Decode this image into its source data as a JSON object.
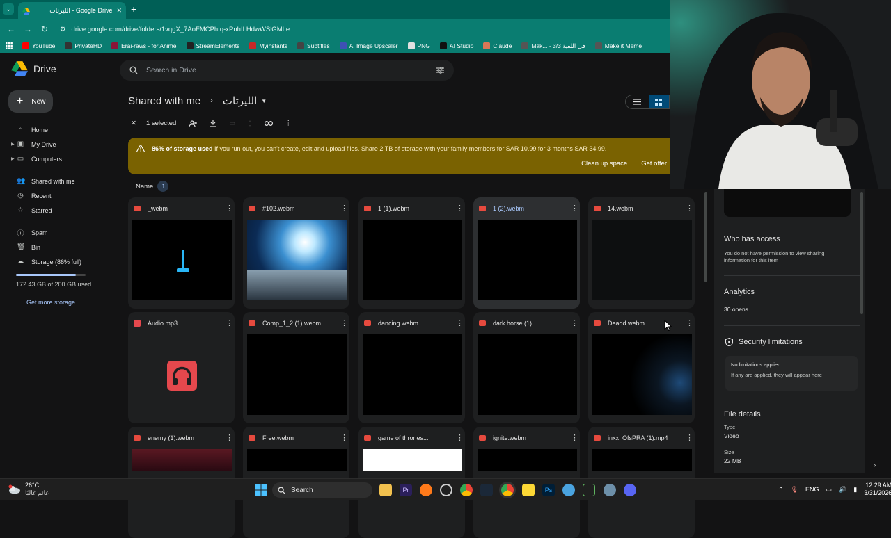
{
  "browser": {
    "tab_title": "الليرتات - Google Drive",
    "url": "drive.google.com/drive/folders/1vqgX_7AoFMCPhtq-xPnhILHdwWSlGMLe",
    "bookmarks": [
      {
        "label": "YouTube",
        "color": "#ff0000"
      },
      {
        "label": "PrivateHD",
        "color": "#333333"
      },
      {
        "label": "Erai-raws - for Anime",
        "color": "#8a1538"
      },
      {
        "label": "StreamElements",
        "color": "#222222"
      },
      {
        "label": "Myinstants",
        "color": "#c62828"
      },
      {
        "label": "Subtitles",
        "color": "#444444"
      },
      {
        "label": "AI Image Upscaler",
        "color": "#3f51b5"
      },
      {
        "label": "PNG",
        "color": "#e0e0e0"
      },
      {
        "label": "AI Studio",
        "color": "#111111"
      },
      {
        "label": "Claude",
        "color": "#d97757"
      },
      {
        "label": "Mak... - 3/3 في اللعبة",
        "color": "#555555"
      },
      {
        "label": "Make it Meme",
        "color": "#555555"
      }
    ]
  },
  "drive": {
    "app_name": "Drive",
    "search_placeholder": "Search in Drive",
    "new_label": "New",
    "nav": [
      {
        "label": "Home",
        "icon": "home-icon"
      },
      {
        "label": "My Drive",
        "icon": "my-drive-icon"
      },
      {
        "label": "Computers",
        "icon": "computers-icon"
      },
      {
        "label": "Shared with me",
        "icon": "shared-icon"
      },
      {
        "label": "Recent",
        "icon": "recent-icon"
      },
      {
        "label": "Starred",
        "icon": "star-icon"
      },
      {
        "label": "Spam",
        "icon": "spam-icon"
      },
      {
        "label": "Bin",
        "icon": "bin-icon"
      },
      {
        "label": "Storage (86% full)",
        "icon": "cloud-icon"
      }
    ],
    "storage_used_fraction": 0.86,
    "storage_text": "172.43 GB of 200 GB used",
    "get_more_storage": "Get more storage",
    "breadcrumb": {
      "root": "Shared with me",
      "folder": "الليرتات"
    },
    "selection": {
      "count_label": "1 selected"
    },
    "banner": {
      "bold": "86% of storage used",
      "text": "If you run out, you can't create, edit and upload files. Share 2 TB of storage with your family members for SAR 10.99 for 3 months",
      "old_price": "SAR 34.99.",
      "action1": "Clean up space",
      "action2": "Get offer",
      "color": "#7a6201"
    },
    "sort_label": "Name",
    "files": [
      {
        "name": "_webm",
        "kind": "video",
        "thumb": "letter",
        "selected": false
      },
      {
        "name": "#102.webm",
        "kind": "video",
        "thumb": "sky",
        "selected": false
      },
      {
        "name": "1 (1).webm",
        "kind": "video",
        "thumb": "black",
        "selected": false
      },
      {
        "name": "1 (2).webm",
        "kind": "video",
        "thumb": "black",
        "selected": true
      },
      {
        "name": "14.webm",
        "kind": "video",
        "thumb": "dark",
        "selected": false
      },
      {
        "name": "Audio.mp3",
        "kind": "audio",
        "thumb": "audio",
        "selected": false
      },
      {
        "name": "Comp_1_2 (1).webm",
        "kind": "video",
        "thumb": "black",
        "selected": false
      },
      {
        "name": "dancing.webm",
        "kind": "video",
        "thumb": "black",
        "selected": false
      },
      {
        "name": "dark horse (1)...",
        "kind": "video",
        "thumb": "black",
        "selected": false
      },
      {
        "name": "Deadd.webm",
        "kind": "video",
        "thumb": "glow",
        "selected": false
      },
      {
        "name": "enemy (1).webm",
        "kind": "video",
        "thumb": "red",
        "selected": false
      },
      {
        "name": "Free.webm",
        "kind": "video",
        "thumb": "black",
        "selected": false
      },
      {
        "name": "game of thrones...",
        "kind": "video",
        "thumb": "white",
        "selected": false
      },
      {
        "name": "ignite.webm",
        "kind": "video",
        "thumb": "black",
        "selected": false
      },
      {
        "name": "inxx_OfsPRA (1).mp4",
        "kind": "video",
        "thumb": "black",
        "selected": false
      }
    ],
    "details": {
      "who_has_access": "Who has access",
      "access_text": "You do not have permission to view sharing information for this item",
      "analytics": "Analytics",
      "opens": "30 opens",
      "security": "Security limitations",
      "no_limits": "No limitations applied",
      "limits_sub": "If any are applied, they will appear here",
      "file_details": "File details",
      "type_label": "Type",
      "type_value": "Video",
      "size_label": "Size",
      "size_value": "22 MB"
    }
  },
  "taskbar": {
    "temp": "26°C",
    "weather_text": "غائم غالبًا",
    "search": "Search",
    "lang": "ENG",
    "time": "12:29 AM",
    "date": "3/31/2026"
  }
}
